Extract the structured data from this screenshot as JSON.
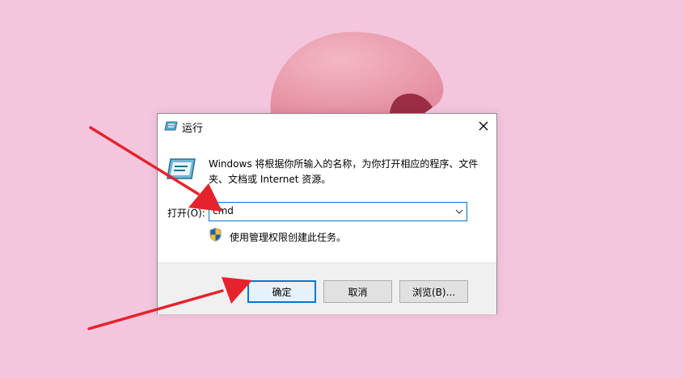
{
  "dialog": {
    "title": "运行",
    "description": "Windows 将根据你所输入的名称，为你打开相应的程序、文件夹、文档或 Internet 资源。",
    "open_label": "打开(O):",
    "input_value": "cmd",
    "admin_note": "使用管理权限创建此任务。",
    "buttons": {
      "ok": "确定",
      "cancel": "取消",
      "browse": "浏览(B)..."
    }
  },
  "colors": {
    "background": "#f4c6de",
    "accent": "#0078d7",
    "arrow": "#e5232c"
  }
}
